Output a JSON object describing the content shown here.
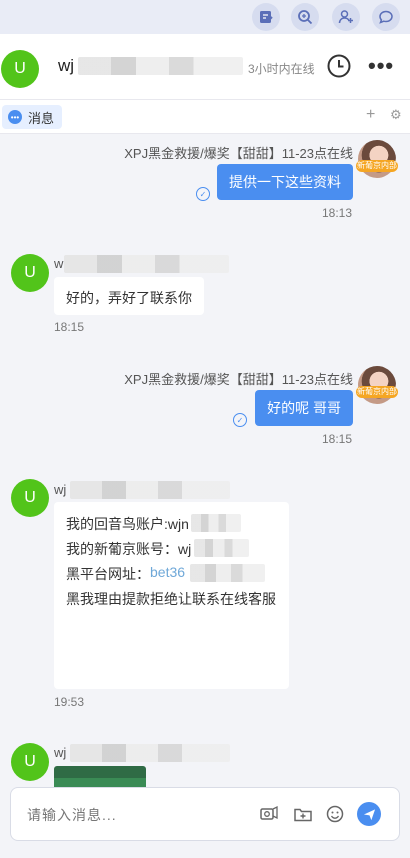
{
  "toolbar": {
    "icons": [
      "note-edit-icon",
      "search-zoom-icon",
      "user-add-icon",
      "chat-bubble-icon"
    ]
  },
  "header": {
    "avatar_letter": "U",
    "name": "wj",
    "status": "3小时内在线"
  },
  "tabs": {
    "active_label": "消息",
    "add_label": "+",
    "settings_label": "⚙"
  },
  "messages": [
    {
      "side": "right",
      "sender": "XPJ黑金救援/爆奖【甜甜】11-23点在线",
      "agent_tag": "新葡京内部",
      "text": "提供一下这些资料",
      "time": "18:13"
    },
    {
      "side": "left",
      "sender": "w",
      "avatar_letter": "U",
      "text": "好的，弄好了联系你",
      "time": "18:15"
    },
    {
      "side": "right",
      "sender": "XPJ黑金救援/爆奖【甜甜】11-23点在线",
      "agent_tag": "新葡京内部",
      "text": "好的呢 哥哥",
      "time": "18:15"
    },
    {
      "side": "left",
      "sender": "wj",
      "avatar_letter": "U",
      "lines": [
        "我的回音鸟账户:wjn",
        "我的新葡京账号：wj",
        "黑平台网址：",
        "黑我理由提款拒绝让联系在线客服"
      ],
      "link": "bet36",
      "time": "19:53"
    },
    {
      "side": "left",
      "sender": "wj",
      "avatar_letter": "U"
    }
  ],
  "input": {
    "placeholder": "请输入消息..."
  },
  "input_icons": [
    "screenshot-icon",
    "folder-add-icon",
    "emoji-icon",
    "send-icon"
  ]
}
